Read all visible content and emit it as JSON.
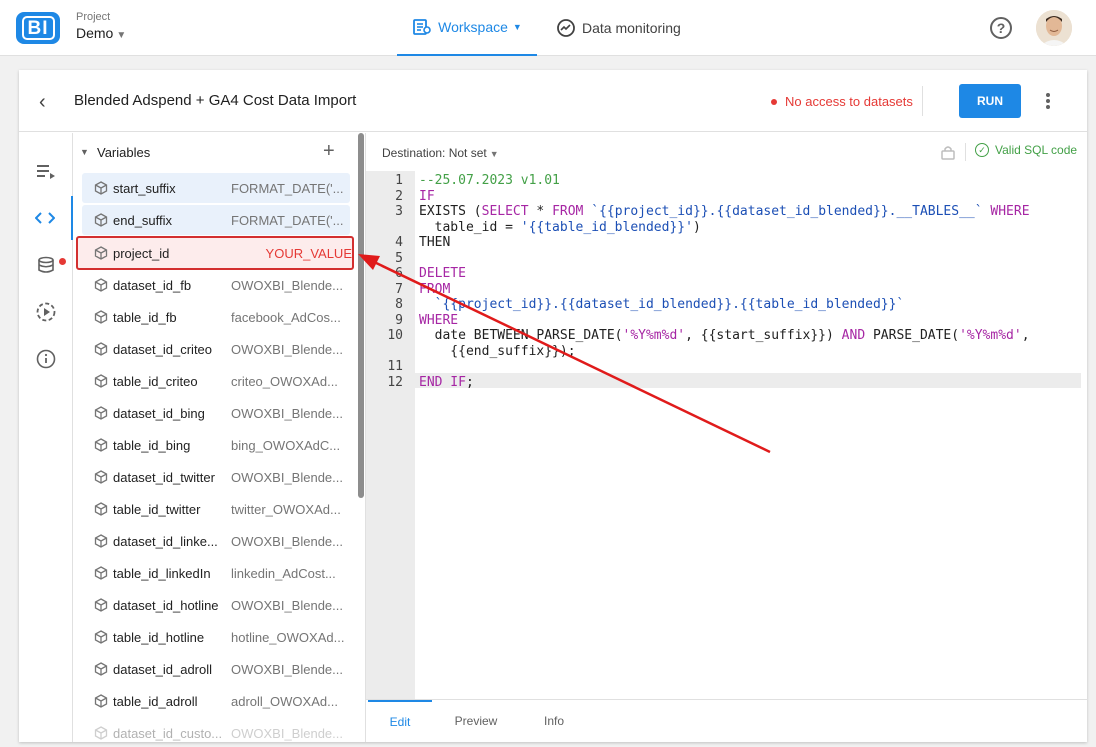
{
  "topbar": {
    "logo": "BI",
    "project_label": "Project",
    "project_name": "Demo",
    "tabs": [
      {
        "label": "Workspace",
        "icon": "workspace-icon",
        "active": true
      },
      {
        "label": "Data monitoring",
        "icon": "monitoring-icon",
        "active": false
      }
    ],
    "help_icon": "?"
  },
  "card": {
    "back_icon": "‹",
    "title": "Blended Adspend + GA4 Cost Data Import",
    "access_warning": "No access to datasets",
    "run_label": "RUN"
  },
  "variables": {
    "title": "Variables",
    "add_icon": "+",
    "items": [
      {
        "name": "start_suffix",
        "value": "FORMAT_DATE('..."
      },
      {
        "name": "end_suffix",
        "value": "FORMAT_DATE('..."
      },
      {
        "name": "project_id",
        "value": "YOUR_VALUE"
      },
      {
        "name": "dataset_id_fb",
        "value": "OWOXBI_Blende..."
      },
      {
        "name": "table_id_fb",
        "value": "facebook_AdCos..."
      },
      {
        "name": "dataset_id_criteo",
        "value": "OWOXBI_Blende..."
      },
      {
        "name": "table_id_criteo",
        "value": "criteo_OWOXAd..."
      },
      {
        "name": "dataset_id_bing",
        "value": "OWOXBI_Blende..."
      },
      {
        "name": "table_id_bing",
        "value": "bing_OWOXAdC..."
      },
      {
        "name": "dataset_id_twitter",
        "value": "OWOXBI_Blende..."
      },
      {
        "name": "table_id_twitter",
        "value": "twitter_OWOXAd..."
      },
      {
        "name": "dataset_id_linke...",
        "value": "OWOXBI_Blende..."
      },
      {
        "name": "table_id_linkedIn",
        "value": "linkedin_AdCost..."
      },
      {
        "name": "dataset_id_hotline",
        "value": "OWOXBI_Blende..."
      },
      {
        "name": "table_id_hotline",
        "value": "hotline_OWOXAd..."
      },
      {
        "name": "dataset_id_adroll",
        "value": "OWOXBI_Blende..."
      },
      {
        "name": "table_id_adroll",
        "value": "adroll_OWOXAd..."
      },
      {
        "name": "dataset_id_custo...",
        "value": "OWOXBI_Blende..."
      }
    ]
  },
  "editor": {
    "destination": "Destination: Not set",
    "valid_label": "Valid SQL code",
    "line_numbers": [
      "1",
      "2",
      "3",
      "",
      "4",
      "5",
      "6",
      "7",
      "8",
      "9",
      "10",
      "",
      "11",
      "12"
    ],
    "tabs": [
      "Edit",
      "Preview",
      "Info"
    ]
  },
  "colors": {
    "accent": "#1e88e5",
    "error": "#e53935",
    "success": "#43a047",
    "keyword": "#a626a4",
    "string": "#1c4fb5"
  }
}
